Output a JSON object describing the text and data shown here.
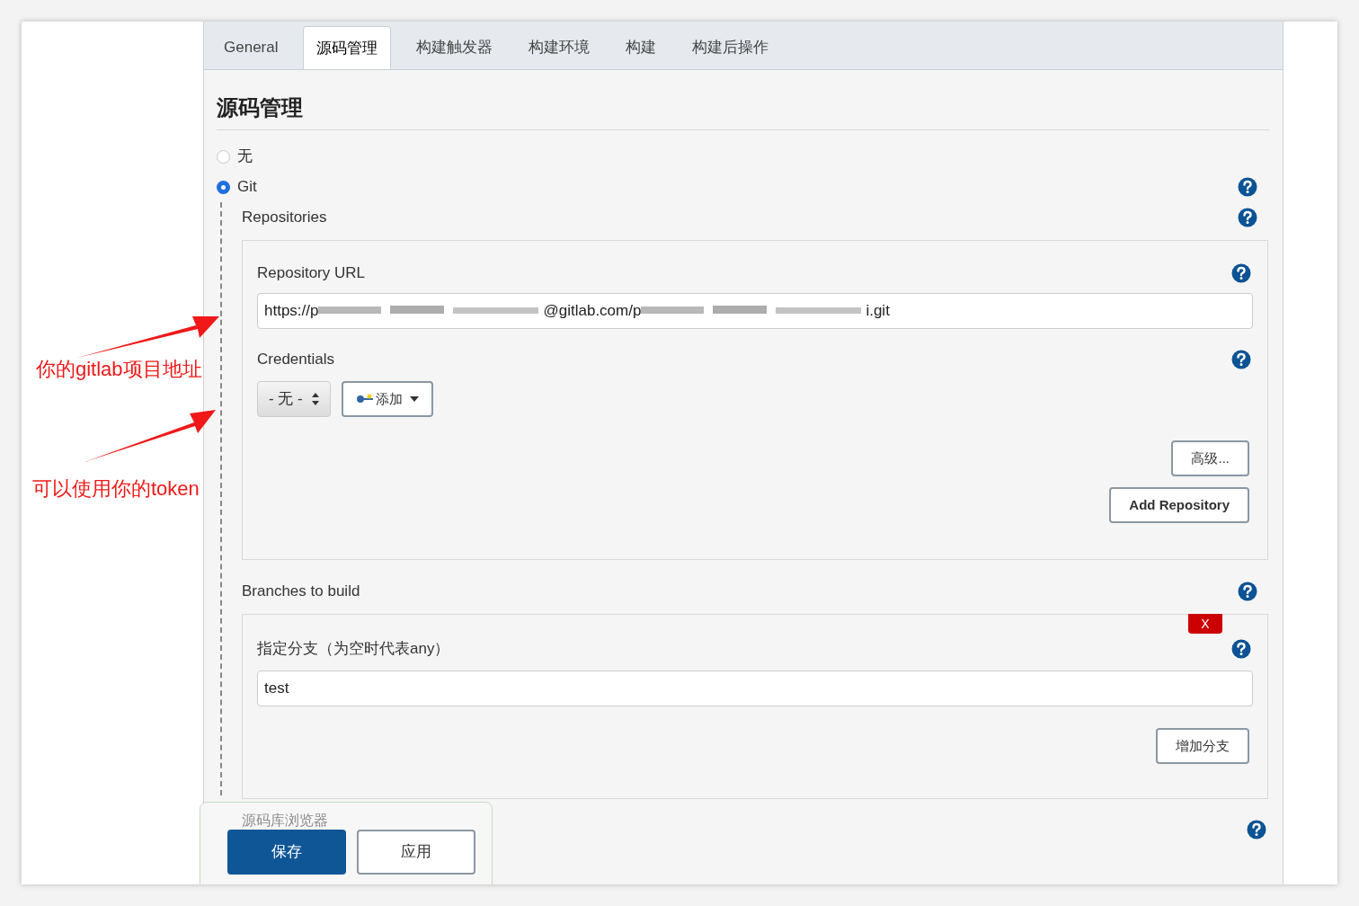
{
  "tabs": [
    {
      "label": "General",
      "selected": false
    },
    {
      "label": "源码管理",
      "selected": true
    },
    {
      "label": "构建触发器",
      "selected": false
    },
    {
      "label": "构建环境",
      "selected": false
    },
    {
      "label": "构建",
      "selected": false
    },
    {
      "label": "构建后操作",
      "selected": false
    }
  ],
  "section_title": "源码管理",
  "scm_options": [
    {
      "label": "无",
      "selected": false,
      "help": false
    },
    {
      "label": "Git",
      "selected": true,
      "help": true
    }
  ],
  "repositories": {
    "label": "Repositories",
    "url_label": "Repository URL",
    "url_parts": [
      {
        "kind": "text",
        "text": "https://p"
      },
      {
        "kind": "redacted"
      },
      {
        "kind": "text",
        "text": "@gitlab.com/p"
      },
      {
        "kind": "redacted"
      },
      {
        "kind": "text",
        "text": "i.git"
      }
    ],
    "credentials_label": "Credentials",
    "credentials_value": "- 无 -",
    "add_button": "添加",
    "advanced_button": "高级...",
    "add_repository_button": "Add Repository"
  },
  "branches": {
    "label": "Branches to build",
    "delete_button": "X",
    "branch_label": "指定分支（为空时代表any）",
    "branch_value": "test",
    "add_branch_button": "增加分支"
  },
  "browser_label": "源码库浏览器",
  "footer": {
    "save_button": "保存",
    "apply_button": "应用"
  },
  "annotations": [
    {
      "text": "你的gitlab项目地址"
    },
    {
      "text": "可以使用你的token"
    }
  ]
}
